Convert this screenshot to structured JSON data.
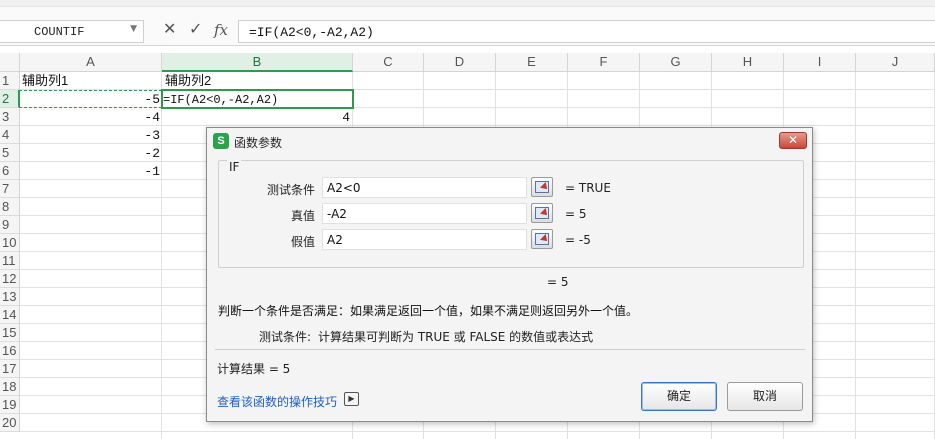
{
  "formula_bar": {
    "name_box": "COUNTIF",
    "cancel_glyph": "✕",
    "confirm_glyph": "✓",
    "fx_label": "fx",
    "formula": "=IF(A2<0,-A2,A2)"
  },
  "sheet": {
    "columns": [
      "A",
      "B",
      "C",
      "D",
      "E",
      "F",
      "G",
      "H",
      "I",
      "J"
    ],
    "selected_column": "B",
    "rows": [
      "1",
      "2",
      "3",
      "4",
      "5",
      "6",
      "7",
      "8",
      "9",
      "10",
      "11",
      "12",
      "13",
      "14",
      "15",
      "16",
      "17",
      "18",
      "19",
      "20"
    ],
    "selected_row": "2",
    "cells": {
      "A1": "辅助列1",
      "B1": "辅助列2",
      "A2": "-5",
      "B2": "=IF(A2<0,-A2,A2)",
      "A3": "-4",
      "B3": "4",
      "A4": "-3",
      "A5": "-2",
      "A6": "-1"
    }
  },
  "dialog": {
    "title": "函数参数",
    "logo_letter": "S",
    "close_glyph": "✕",
    "function_name": "IF",
    "args": [
      {
        "label": "测试条件",
        "value": "A2<0",
        "result": "= TRUE"
      },
      {
        "label": "真值",
        "value": "-A2",
        "result": "= 5"
      },
      {
        "label": "假值",
        "value": "A2",
        "result": "= -5"
      }
    ],
    "overall_result": "= 5",
    "description": "判断一个条件是否满足：如果满足返回一个值，如果不满足则返回另外一个值。",
    "param_desc_label": "测试条件:",
    "param_desc_text": "计算结果可判断为 TRUE 或 FALSE 的数值或表达式",
    "calc_result": "计算结果 =  5",
    "help_link": "查看该函数的操作技巧",
    "help_icon_glyph": "▶",
    "ok_label": "确定",
    "cancel_label": "取消"
  }
}
